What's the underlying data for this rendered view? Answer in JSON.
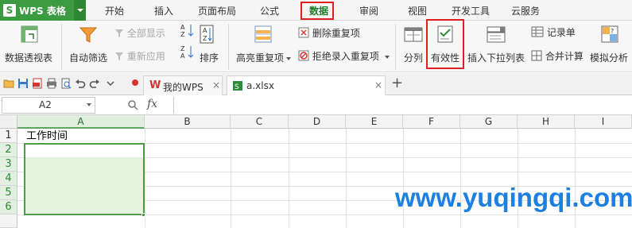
{
  "app": {
    "title": "WPS 表格",
    "logo_letter": "S"
  },
  "menu": {
    "tabs": [
      {
        "label": "开始"
      },
      {
        "label": "插入"
      },
      {
        "label": "页面布局"
      },
      {
        "label": "公式"
      },
      {
        "label": "数据",
        "active": true
      },
      {
        "label": "审阅"
      },
      {
        "label": "视图"
      },
      {
        "label": "开发工具"
      },
      {
        "label": "云服务"
      }
    ]
  },
  "ribbon": {
    "pivot": "数据透视表",
    "autofilter": "自动筛选",
    "show_all": "全部显示",
    "reapply": "重新应用",
    "sort": "排序",
    "highlight_dup": "高亮重复项",
    "delete_dup": "删除重复项",
    "reject_dup": "拒绝录入重复项",
    "split": "分列",
    "validity": "有效性",
    "insert_dropdown": "插入下拉列表",
    "record_form": "记录单",
    "consolidate": "合并计算",
    "what_if": "模拟分析"
  },
  "quickbar": {
    "doc_tabs": [
      {
        "label": "我的WPS",
        "icon": "wps-logo-icon"
      },
      {
        "label": "a.xlsx",
        "icon": "excel-file-icon",
        "active": true
      }
    ],
    "new_tab": "+"
  },
  "formula_bar": {
    "name_box": "A2",
    "fx": "fx",
    "formula": ""
  },
  "grid": {
    "columns": [
      "A",
      "B",
      "C",
      "D",
      "E",
      "F",
      "G",
      "H",
      "I"
    ],
    "rows": [
      "1",
      "2",
      "3",
      "4",
      "5",
      "6"
    ],
    "cells": {
      "A1": "工作时间"
    },
    "selection": "A2:A6"
  },
  "watermark": "www.yuqingqi.com",
  "colors": {
    "accent_green": "#3c9b41",
    "highlight_red": "#e02020",
    "watermark_blue": "#1d7fe0"
  }
}
